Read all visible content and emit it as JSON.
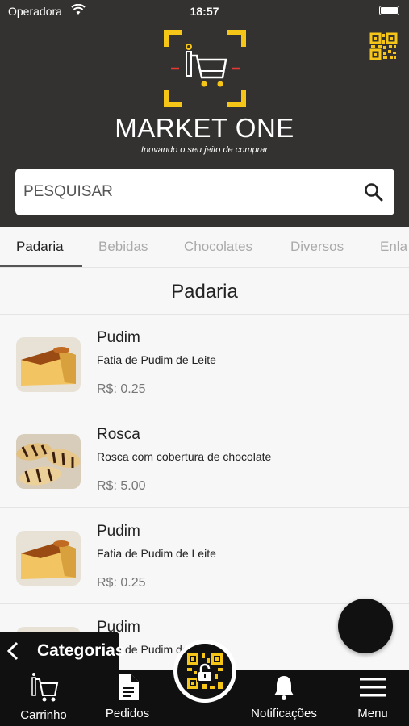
{
  "status_bar": {
    "carrier": "Operadora",
    "time": "18:57"
  },
  "header": {
    "brand": "MARKET ONE",
    "tagline": "Inovando o seu jeito de comprar"
  },
  "search": {
    "placeholder": "PESQUISAR"
  },
  "tabs": [
    {
      "label": "Padaria",
      "active": true
    },
    {
      "label": "Bebidas",
      "active": false
    },
    {
      "label": "Chocolates",
      "active": false
    },
    {
      "label": "Diversos",
      "active": false
    },
    {
      "label": "Enla",
      "active": false
    }
  ],
  "section_title": "Padaria",
  "items": [
    {
      "name": "Pudim",
      "description": "Fatia de Pudim de Leite",
      "price": "R$: 0.25",
      "image": "pudim"
    },
    {
      "name": "Rosca",
      "description": "Rosca com cobertura de chocolate",
      "price": "R$: 5.00",
      "image": "rosca"
    },
    {
      "name": "Pudim",
      "description": "Fatia de Pudim de Leite",
      "price": "R$: 0.25",
      "image": "pudim"
    },
    {
      "name": "Pudim",
      "description": "Fatia de Pudim de Leite",
      "price": "",
      "image": "pudim"
    }
  ],
  "categories_tab": {
    "label": "Categorias",
    "icon": "chevron-left-icon"
  },
  "bottom_nav": [
    {
      "label": "Carrinho",
      "icon": "cart-icon"
    },
    {
      "label": "Pedidos",
      "icon": "document-icon"
    },
    {
      "label": "",
      "icon": "qr-unlock-icon"
    },
    {
      "label": "Notificações",
      "icon": "bell-icon"
    },
    {
      "label": "Menu",
      "icon": "hamburger-icon"
    }
  ],
  "colors": {
    "header_bg": "#333230",
    "accent_yellow": "#f5c518",
    "accent_red": "#e53935",
    "nav_bg": "#101010"
  }
}
